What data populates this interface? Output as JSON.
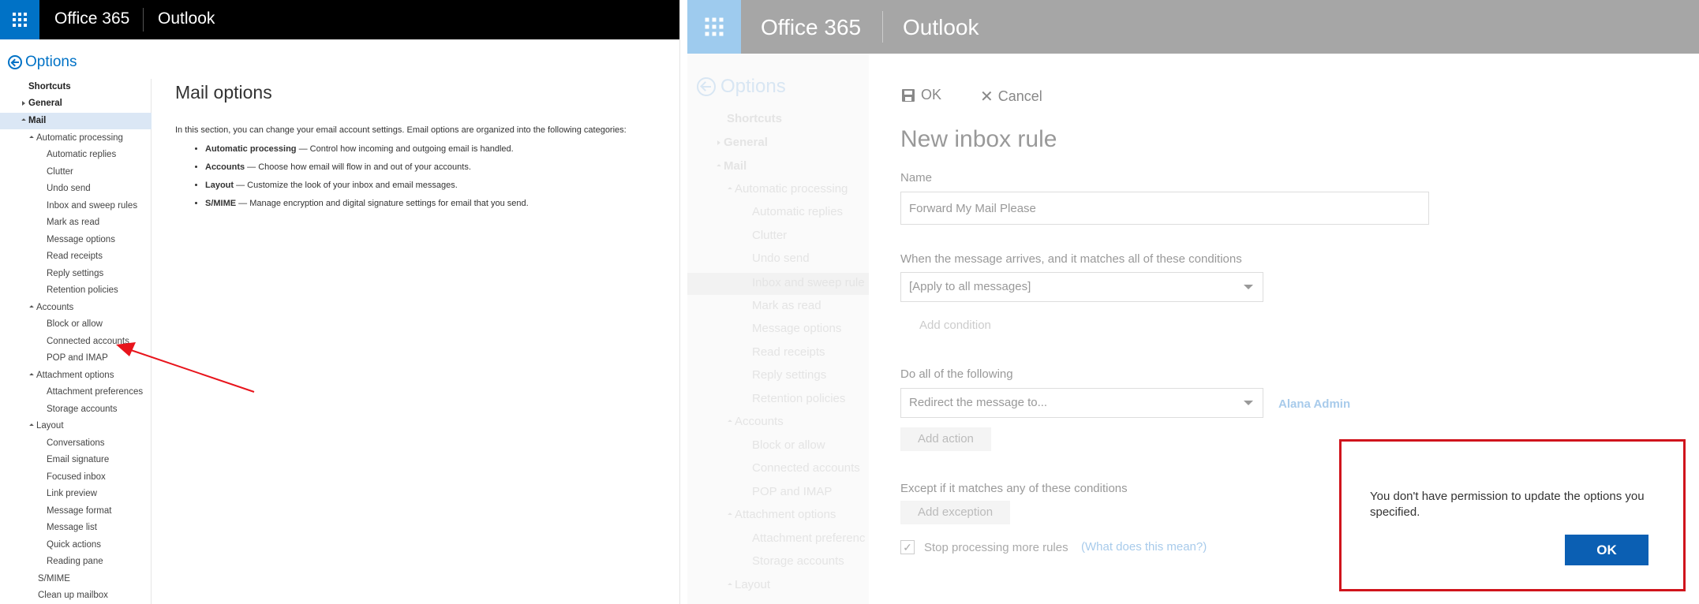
{
  "left": {
    "brand": "Office 365",
    "app": "Outlook",
    "options_title": "Options",
    "nav": {
      "shortcuts": "Shortcuts",
      "general": "General",
      "mail": "Mail",
      "automatic_processing": "Automatic processing",
      "automatic_replies": "Automatic replies",
      "clutter": "Clutter",
      "undo_send": "Undo send",
      "inbox_sweep": "Inbox and sweep rules",
      "mark_as_read": "Mark as read",
      "message_options": "Message options",
      "read_receipts": "Read receipts",
      "reply_settings": "Reply settings",
      "retention_policies": "Retention policies",
      "accounts": "Accounts",
      "block_or_allow": "Block or allow",
      "connected_accounts": "Connected accounts",
      "pop_imap": "POP and IMAP",
      "attachment_options": "Attachment options",
      "attachment_preferences": "Attachment preferences",
      "storage_accounts": "Storage accounts",
      "layout": "Layout",
      "conversations": "Conversations",
      "email_signature": "Email signature",
      "focused_inbox": "Focused inbox",
      "link_preview": "Link preview",
      "message_format": "Message format",
      "message_list": "Message list",
      "quick_actions": "Quick actions",
      "reading_pane": "Reading pane",
      "smime": "S/MIME",
      "clean_up_mailbox": "Clean up mailbox"
    },
    "content": {
      "title": "Mail options",
      "intro": "In this section, you can change your email account settings. Email options are organized into the following categories:",
      "items": [
        {
          "term": "Automatic processing",
          "desc": " — Control how incoming and outgoing email is handled."
        },
        {
          "term": "Accounts",
          "desc": " — Choose how email will flow in and out of your accounts."
        },
        {
          "term": "Layout",
          "desc": " — Customize the look of your inbox and email messages."
        },
        {
          "term": "S/MIME",
          "desc": " — Manage encryption and digital signature settings for email that you send."
        }
      ]
    }
  },
  "right": {
    "brand": "Office 365",
    "app": "Outlook",
    "options_title": "Options",
    "nav": {
      "shortcuts": "Shortcuts",
      "general": "General",
      "mail": "Mail",
      "automatic_processing": "Automatic processing",
      "automatic_replies": "Automatic replies",
      "clutter": "Clutter",
      "undo_send": "Undo send",
      "inbox_sweep": "Inbox and sweep rule",
      "mark_as_read": "Mark as read",
      "message_options": "Message options",
      "read_receipts": "Read receipts",
      "reply_settings": "Reply settings",
      "retention_policies": "Retention policies",
      "accounts": "Accounts",
      "block_or_allow": "Block or allow",
      "connected_accounts": "Connected accounts",
      "pop_imap": "POP and IMAP",
      "attachment_options": "Attachment options",
      "attachment_preferences": "Attachment preferenc",
      "storage_accounts": "Storage accounts",
      "layout": "Layout"
    },
    "toolbar": {
      "ok": "OK",
      "cancel": "Cancel"
    },
    "rule": {
      "title": "New inbox rule",
      "name_label": "Name",
      "name_value": "Forward My Mail Please",
      "conditions_label": "When the message arrives, and it matches all of these conditions",
      "condition_value": "[Apply to all messages]",
      "add_condition": "Add condition",
      "actions_label": "Do all of the following",
      "action_value": "Redirect the message to...",
      "recipient": "Alana Admin",
      "add_action": "Add action",
      "exceptions_label": "Except if it matches any of these conditions",
      "add_exception": "Add exception",
      "stop_processing": "Stop processing more rules",
      "what_does_this_mean": "(What does this mean?)"
    },
    "dialog": {
      "message": "You don't have permission to update the options you specified.",
      "ok": "OK"
    }
  },
  "colors": {
    "office_blue": "#0072c6",
    "dialog_border": "#d0141c",
    "ok_button": "#0b5fb3",
    "annotation_arrow": "#e8141c"
  }
}
